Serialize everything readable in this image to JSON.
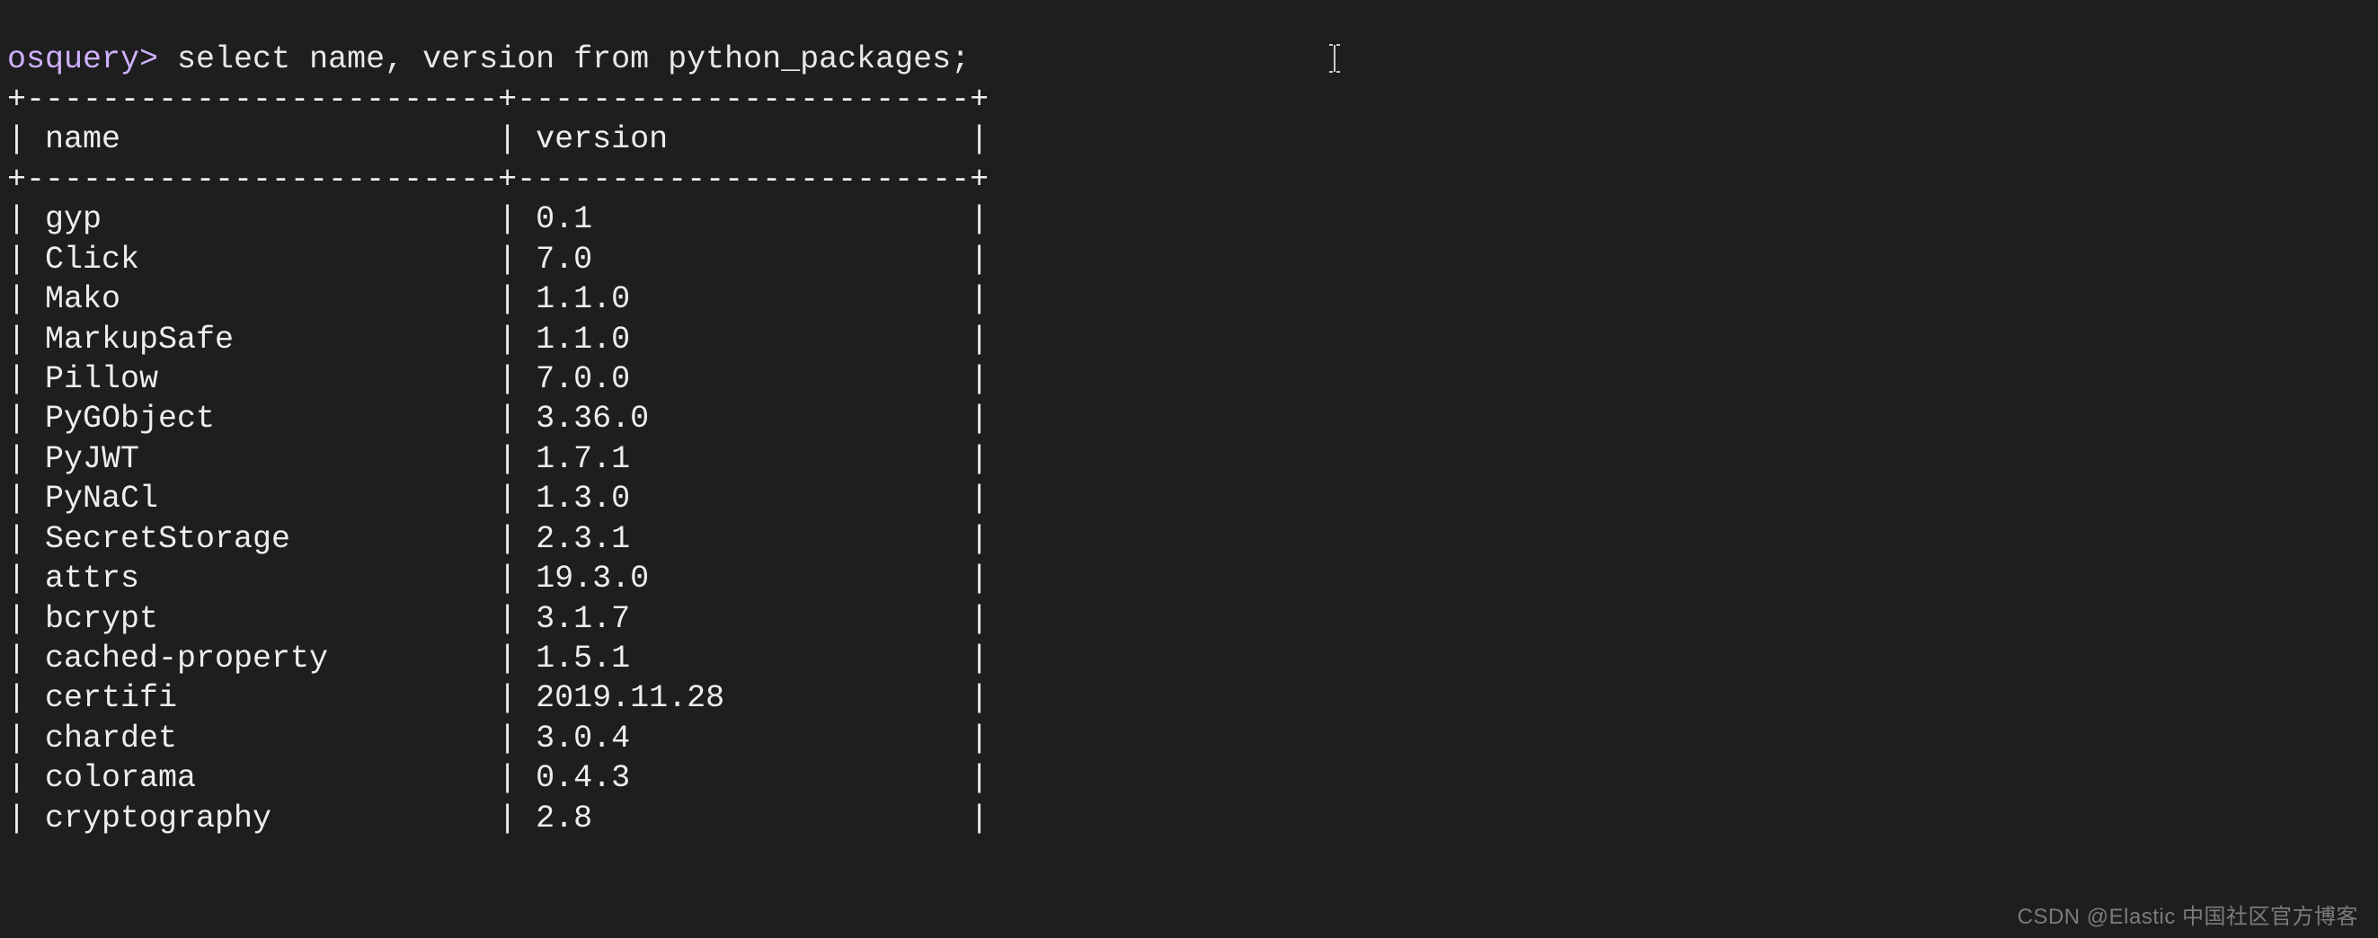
{
  "prompt": "osquery>",
  "query": "select name, version from python_packages;",
  "table": {
    "col1_label": "name",
    "col2_label": "version",
    "col1_width": 25,
    "col2_width": 24,
    "rows": [
      {
        "name": "gyp",
        "version": "0.1"
      },
      {
        "name": "Click",
        "version": "7.0"
      },
      {
        "name": "Mako",
        "version": "1.1.0"
      },
      {
        "name": "MarkupSafe",
        "version": "1.1.0"
      },
      {
        "name": "Pillow",
        "version": "7.0.0"
      },
      {
        "name": "PyGObject",
        "version": "3.36.0"
      },
      {
        "name": "PyJWT",
        "version": "1.7.1"
      },
      {
        "name": "PyNaCl",
        "version": "1.3.0"
      },
      {
        "name": "SecretStorage",
        "version": "2.3.1"
      },
      {
        "name": "attrs",
        "version": "19.3.0"
      },
      {
        "name": "bcrypt",
        "version": "3.1.7"
      },
      {
        "name": "cached-property",
        "version": "1.5.1"
      },
      {
        "name": "certifi",
        "version": "2019.11.28"
      },
      {
        "name": "chardet",
        "version": "3.0.4"
      },
      {
        "name": "colorama",
        "version": "0.4.3"
      },
      {
        "name": "cryptography",
        "version": "2.8"
      }
    ]
  },
  "watermark": "CSDN @Elastic 中国社区官方博客"
}
